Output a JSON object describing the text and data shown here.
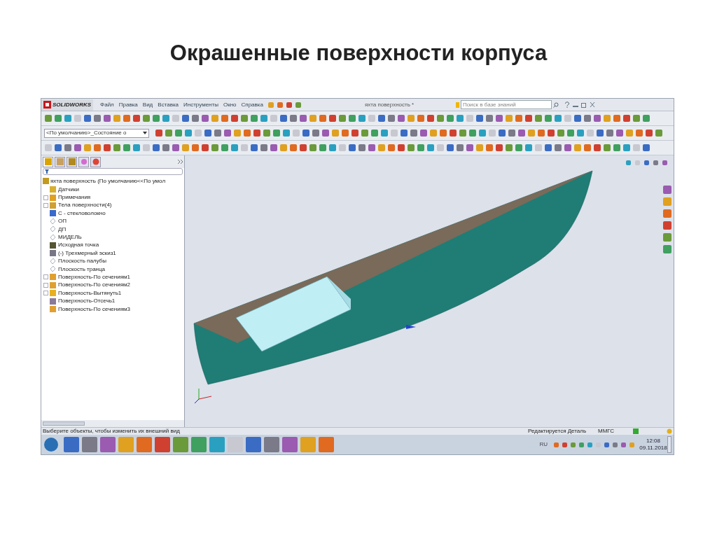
{
  "slide": {
    "title": "Окрашенные поверхности корпуса"
  },
  "app": {
    "logo": "SOLIDWORKS",
    "menu": [
      "Файл",
      "Правка",
      "Вид",
      "Вставка",
      "Инструменты",
      "Окно",
      "Справка"
    ],
    "document_title": "яхта поверхность *",
    "search": {
      "placeholder": "Поиск в базе знаний"
    },
    "configuration": "<По умолчанию>_Состояние о"
  },
  "tree": {
    "panel_tabs": [
      {
        "selected": true
      },
      {
        "selected": false
      },
      {
        "selected": false
      },
      {
        "selected": false
      },
      {
        "selected": false
      }
    ],
    "root": "яхта поверхность  (По умолчанию<<По умол",
    "items": [
      {
        "label": "Датчики",
        "kind": "sensor",
        "collapsible": false
      },
      {
        "label": "Примечания",
        "kind": "note",
        "collapsible": true
      },
      {
        "label": "Тела поверхности(4)",
        "kind": "body",
        "collapsible": true
      },
      {
        "label": "С - стекловолокно",
        "kind": "material",
        "collapsible": false
      },
      {
        "label": "ОП",
        "kind": "plane",
        "collapsible": false
      },
      {
        "label": "ДП",
        "kind": "plane",
        "collapsible": false
      },
      {
        "label": "МИДЕЛЬ",
        "kind": "plane",
        "collapsible": false
      },
      {
        "label": "Исходная точка",
        "kind": "origin",
        "collapsible": false
      },
      {
        "label": "(-) Трехмерный эскиз1",
        "kind": "sketch",
        "collapsible": false
      },
      {
        "label": "Плоскость палубы",
        "kind": "plane",
        "collapsible": false
      },
      {
        "label": "Плоскость транца",
        "kind": "plane",
        "collapsible": false
      },
      {
        "label": "Поверхность-По сечениям1",
        "kind": "loft",
        "collapsible": true
      },
      {
        "label": "Поверхность-По сечениям2",
        "kind": "loft",
        "collapsible": true
      },
      {
        "label": "Поверхность-Вытянуть1",
        "kind": "extrude",
        "collapsible": true
      },
      {
        "label": "Поверхность-Отсечь1",
        "kind": "trim",
        "collapsible": false
      },
      {
        "label": "Поверхность-По сечениям3",
        "kind": "loft",
        "collapsible": false
      }
    ]
  },
  "status_bar": {
    "message": "Выберите объекты, чтобы изменить их внешний вид",
    "mode": "Редактируется Деталь",
    "units": "ММГС"
  },
  "taskbar": {
    "language": "RU",
    "time": "12:08",
    "date": "09.11.2018"
  }
}
